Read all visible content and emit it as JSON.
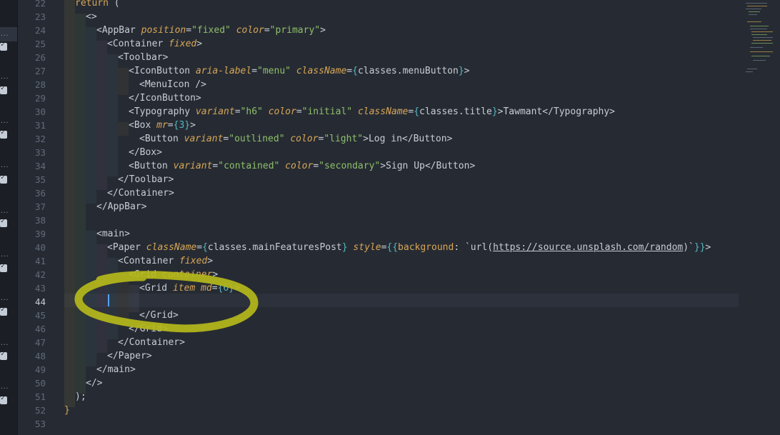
{
  "gutter": {
    "lines": [
      "22",
      "23",
      "24",
      "25",
      "26",
      "27",
      "28",
      "29",
      "30",
      "31",
      "32",
      "33",
      "34",
      "35",
      "36",
      "37",
      "38",
      "39",
      "40",
      "41",
      "42",
      "43",
      "44",
      "45",
      "46",
      "47",
      "48",
      "49",
      "50",
      "51",
      "52",
      "53"
    ],
    "current_line": "44"
  },
  "code": {
    "l22": [
      "return",
      "("
    ],
    "l23": "<>",
    "l24": [
      "<AppBar",
      "position",
      "=",
      "\"fixed\"",
      "color",
      "=",
      "\"primary\"",
      ">"
    ],
    "l25": [
      "<Container",
      "fixed",
      ">"
    ],
    "l26": "<Toolbar>",
    "l27": [
      "<IconButton",
      "aria-label",
      "=",
      "\"menu\"",
      "className",
      "=",
      "{",
      "classes.",
      "menuButton",
      "}",
      ">"
    ],
    "l28": "<MenuIcon />",
    "l29": "</IconButton>",
    "l30": [
      "<Typography",
      "variant",
      "=",
      "\"h6\"",
      "color",
      "=",
      "\"initial\"",
      "className",
      "=",
      "{",
      "classes.",
      "title",
      "}",
      ">Tawmant</Typography>"
    ],
    "l31": [
      "<Box",
      "mr",
      "=",
      "{",
      "3",
      "}",
      ">"
    ],
    "l32": [
      "<Button",
      "variant",
      "=",
      "\"outlined\"",
      "color",
      "=",
      "\"light\"",
      ">Log in</Button>"
    ],
    "l33": "</Box>",
    "l34": [
      "<Button",
      "variant",
      "=",
      "\"contained\"",
      "color",
      "=",
      "\"secondary\"",
      ">Sign Up</Button>"
    ],
    "l35": "</Toolbar>",
    "l36": "</Container>",
    "l37": "</AppBar>",
    "l39": "<main>",
    "l40": [
      "<Paper",
      "className",
      "=",
      "{",
      "classes.",
      "mainFeaturesPost",
      "}",
      "style",
      "=",
      "{{",
      "background",
      ": `url(",
      "https://source.unsplash.com/random",
      ")`",
      "}}",
      ">"
    ],
    "l41": [
      "<Container",
      "fixed",
      ">"
    ],
    "l42": [
      "<Grid",
      "container",
      ">"
    ],
    "l43": [
      "<Grid",
      "item",
      "md",
      "=",
      "{",
      "6",
      "}",
      ">"
    ],
    "l45": "</Grid>",
    "l46": "</Grid>",
    "l47": "</Container>",
    "l48": "</Paper>",
    "l49": "</main>",
    "l50": "</>",
    "l51": ");",
    "l52": "}"
  },
  "colors": {
    "background": "#262b33",
    "tag": "#c8ccd4",
    "attribute": "#d8a657",
    "string": "#8fbf6a",
    "brace": "#56b6c2",
    "annotation": "#b5b81a"
  }
}
